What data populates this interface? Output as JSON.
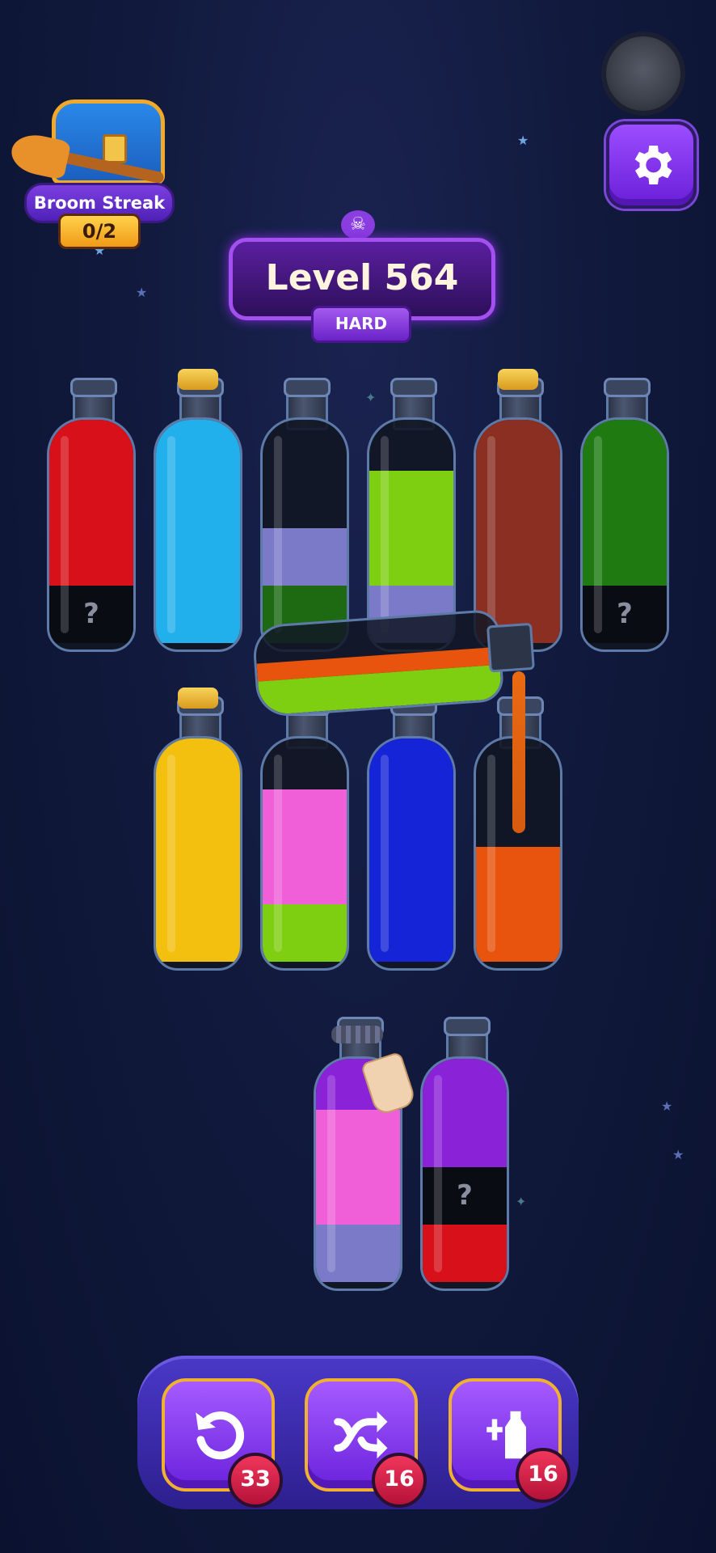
{
  "broom_streak": {
    "label": "Broom Streak",
    "count": "0/2"
  },
  "level": {
    "title": "Level 564",
    "difficulty": "HARD",
    "skull_icon": "skull-icon"
  },
  "colors": {
    "red": "#d8101a",
    "cyan": "#22b0ec",
    "lavender": "#7a7ac8",
    "darkgreen": "#1d6a12",
    "lime": "#7ecf12",
    "brown": "#8a2f22",
    "green": "#1f7a12",
    "yellow": "#f4c010",
    "pink": "#f05ed8",
    "blue": "#1624d8",
    "orange": "#e8540e",
    "purple": "#8a22d8",
    "black": "#0a0c14"
  },
  "bottles_row1": [
    {
      "cork": false,
      "layers": [
        {
          "c": "black",
          "q": true
        },
        {
          "c": "red"
        },
        {
          "c": "red"
        },
        {
          "c": "red"
        }
      ]
    },
    {
      "cork": true,
      "layers": [
        {
          "c": "cyan"
        },
        {
          "c": "cyan"
        },
        {
          "c": "cyan"
        },
        {
          "c": "cyan"
        }
      ]
    },
    {
      "cork": false,
      "layers": [
        {
          "c": "darkgreen"
        },
        {
          "c": "lavender"
        }
      ]
    },
    {
      "cork": false,
      "layers": [
        {
          "c": "lavender"
        },
        {
          "c": "lime"
        },
        {
          "c": "lime"
        }
      ]
    },
    {
      "cork": true,
      "layers": [
        {
          "c": "brown"
        },
        {
          "c": "brown"
        },
        {
          "c": "brown"
        },
        {
          "c": "brown"
        }
      ]
    },
    {
      "cork": false,
      "layers": [
        {
          "c": "black",
          "q": true
        },
        {
          "c": "green"
        },
        {
          "c": "green"
        },
        {
          "c": "green"
        }
      ]
    }
  ],
  "bottles_row2": [
    {
      "cork": true,
      "layers": [
        {
          "c": "yellow"
        },
        {
          "c": "yellow"
        },
        {
          "c": "yellow"
        },
        {
          "c": "yellow"
        }
      ]
    },
    {
      "cork": false,
      "layers": [
        {
          "c": "lime"
        },
        {
          "c": "pink"
        },
        {
          "c": "pink"
        }
      ]
    },
    {
      "cork": false,
      "layers": [
        {
          "c": "blue"
        },
        {
          "c": "blue"
        },
        {
          "c": "blue"
        },
        {
          "c": "blue"
        }
      ]
    },
    {
      "cork": false,
      "layers": [
        {
          "c": "orange"
        },
        {
          "c": "orange"
        }
      ]
    }
  ],
  "bottles_row3": [
    {
      "cork": false,
      "locked": true,
      "layers": [
        {
          "c": "lavender"
        },
        {
          "c": "pink"
        },
        {
          "c": "pink"
        },
        {
          "c": "purple"
        }
      ]
    },
    {
      "cork": false,
      "layers": [
        {
          "c": "red"
        },
        {
          "c": "black",
          "q": true
        },
        {
          "c": "purple"
        },
        {
          "c": "purple"
        }
      ]
    }
  ],
  "tilted_bottle": {
    "layers": [
      "lime",
      "orange"
    ]
  },
  "question_mark": "?",
  "powerups": [
    {
      "name": "undo",
      "icon": "undo-icon",
      "count": "33"
    },
    {
      "name": "shuffle",
      "icon": "shuffle-icon",
      "count": "16"
    },
    {
      "name": "add-bottle",
      "icon": "add-bottle-icon",
      "count": "16"
    }
  ]
}
